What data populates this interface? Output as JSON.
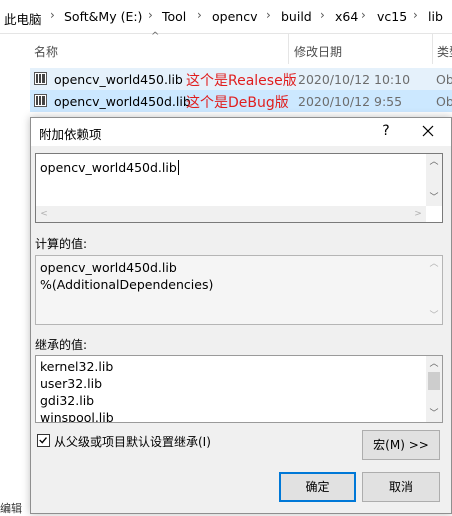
{
  "explorer": {
    "breadcrumb": [
      "此电脑",
      "Soft&My (E:)",
      "Tool",
      "opencv",
      "build",
      "x64",
      "vc15",
      "lib"
    ],
    "columns": {
      "name": "名称",
      "modified": "修改日期",
      "type": "类型"
    },
    "files": [
      {
        "name": "opencv_world450.lib",
        "note": "这个是Realese版",
        "date": "2020/10/12 10:10",
        "type": "Ob"
      },
      {
        "name": "opencv_world450d.lib",
        "note": "这个是DeBug版",
        "date": "2020/10/12 9:55",
        "type": "Ob"
      }
    ],
    "status": "编辑"
  },
  "dialog": {
    "title": "附加依赖项",
    "help_label": "?",
    "input_value": "opencv_world450d.lib",
    "evaluated_label": "计算的值:",
    "evaluated_lines": [
      "opencv_world450d.lib",
      "%(AdditionalDependencies)"
    ],
    "inherited_label": "继承的值:",
    "inherited_lines": [
      "kernel32.lib",
      "user32.lib",
      "gdi32.lib",
      "winspool.lib"
    ],
    "inherit_checkbox_label": "从父级或项目默认设置继承(I)",
    "inherit_checked": true,
    "macro_button": "宏(M) >>",
    "ok_button": "确定",
    "cancel_button": "取消",
    "accent": "#0078d7"
  }
}
